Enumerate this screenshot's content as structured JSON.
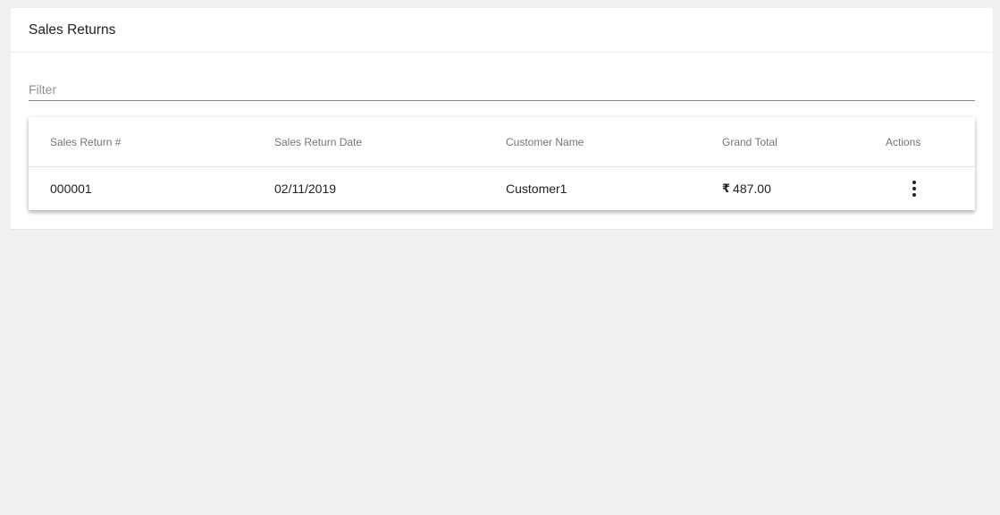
{
  "page": {
    "title": "Sales Returns"
  },
  "filter": {
    "placeholder": "Filter",
    "value": ""
  },
  "table": {
    "columns": [
      "Sales Return #",
      "Sales Return Date",
      "Customer Name",
      "Grand Total",
      "Actions"
    ],
    "rows": [
      {
        "number": "000001",
        "date": "02/11/2019",
        "customer": "Customer1",
        "currency_symbol": "₹",
        "grand_total": "487.00",
        "actions_icon": "more-vert-icon"
      }
    ]
  },
  "colors": {
    "background": "#f0f0f0",
    "card": "#ffffff",
    "header_text": "#757575"
  }
}
